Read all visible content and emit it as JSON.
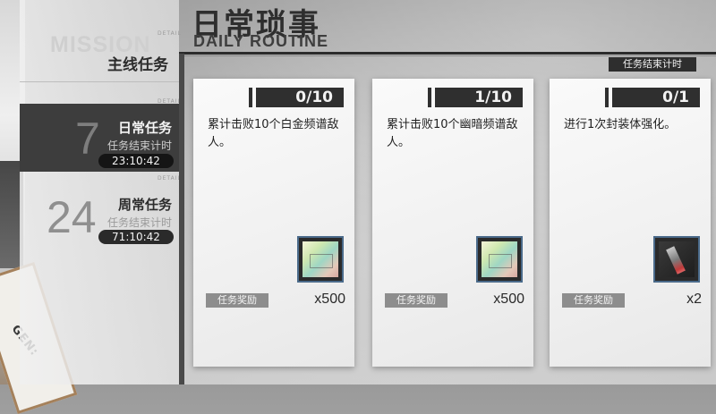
{
  "header": {
    "title": "日常琐事",
    "subtitle": "DAILY ROUTINE",
    "timer_label": "任务结束计时"
  },
  "sidebar": {
    "watermark": "MISSION",
    "detail_tag": "DETAIL",
    "main": {
      "label": "主线任务"
    },
    "daily": {
      "number": "7",
      "label": "日常任务",
      "sub_label": "任务结束计时",
      "timer": "23:10:42"
    },
    "weekly": {
      "number": "24",
      "label": "周常任务",
      "sub_label": "任务结束计时",
      "timer": "71:10:42"
    }
  },
  "missions": [
    {
      "progress": "0/10",
      "description": "累计击败10个白金频谱敌人。",
      "reward_label": "任务奖励",
      "reward_qty": "x500",
      "reward_icon": "ticket-icon"
    },
    {
      "progress": "1/10",
      "description": "累计击败10个幽暗频谱敌人。",
      "reward_label": "任务奖励",
      "reward_qty": "x500",
      "reward_icon": "ticket-icon"
    },
    {
      "progress": "0/1",
      "description": "进行1次封装体强化。",
      "reward_label": "任务奖励",
      "reward_qty": "x2",
      "reward_icon": "module-icon"
    }
  ],
  "decor": {
    "corner_text": "GEN:"
  }
}
